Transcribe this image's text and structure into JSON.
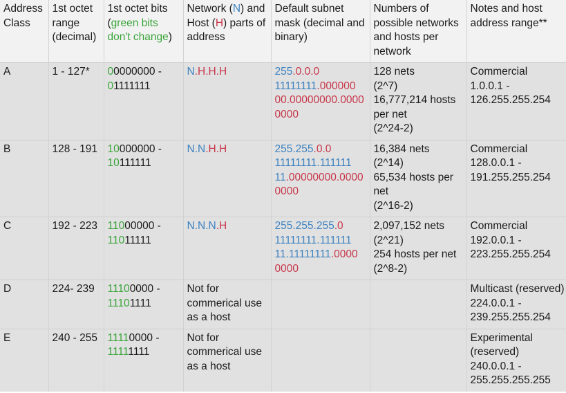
{
  "colors": {
    "network": "#3d82c0",
    "host": "#c7364a",
    "fixed_bits": "#3aa43a",
    "header_bg": "#f2f2f2",
    "row_bg": "#e1e1e1"
  },
  "header": {
    "col1": "Address Class",
    "col2": "1st octet range (decimal)",
    "col3": {
      "pre": "1st octet bits (",
      "green": "green bits don't change",
      "post": ")"
    },
    "col4": {
      "a": "Network (",
      "n": "N",
      "b": ") and Host (",
      "h": "H",
      "c": ") parts of address"
    },
    "col5": "Default subnet mask (decimal and binary)",
    "col6": "Numbers of possible networks and hosts per network",
    "col7": "Notes and host address range**"
  },
  "rows": [
    {
      "cls": "A",
      "range": "1 - 127*",
      "bits": {
        "start_fixed": "0",
        "start_rest": "0000000 -",
        "end_fixed": "0",
        "end_rest": "1111111"
      },
      "parts": {
        "n": "N",
        "h": ".H.H.H"
      },
      "mask": {
        "dec_n": "255",
        "dec_h": ".0.0.0",
        "bin1_n": "11111111",
        "bin1_h": ".000000",
        "bin2_n": "",
        "bin2_h": "00.00000000.0000",
        "bin3_h": "0000"
      },
      "counts": [
        "128 nets",
        "(2^7)",
        "16,777,214 hosts",
        "per net",
        "(2^24-2)"
      ],
      "notes": [
        "Commercial",
        "1.0.0.1 -",
        "126.255.255.254"
      ]
    },
    {
      "cls": "B",
      "range": "128 - 191",
      "bits": {
        "start_fixed": "10",
        "start_rest": "000000 -",
        "end_fixed": "10",
        "end_rest": "111111"
      },
      "parts": {
        "n": "N.N",
        "h": ".H.H"
      },
      "mask": {
        "dec_n": "255.255",
        "dec_h": ".0.0",
        "bin1_n": "11111111.111111",
        "bin1_h": "",
        "bin2_n": "11",
        "bin2_h": ".00000000.0000",
        "bin3_h": "0000"
      },
      "counts": [
        "16,384 nets",
        "(2^14)",
        "65,534 hosts per",
        "net",
        "(2^16-2)"
      ],
      "notes": [
        "Commercial",
        "128.0.0.1 -",
        "191.255.255.254"
      ]
    },
    {
      "cls": "C",
      "range": "192 - 223",
      "bits": {
        "start_fixed": "110",
        "start_rest": "00000 -",
        "end_fixed": "110",
        "end_rest": "11111"
      },
      "parts": {
        "n": "N.N.N",
        "h": ".H"
      },
      "mask": {
        "dec_n": "255.255.255",
        "dec_h": ".0",
        "bin1_n": "11111111.111111",
        "bin1_h": "",
        "bin2_n": "11.11111111",
        "bin2_h": ".0000",
        "bin3_h": "0000"
      },
      "counts": [
        "2,097,152 nets",
        "(2^21)",
        "254 hosts per net",
        "(2^8-2)"
      ],
      "notes": [
        "Commercial",
        "192.0.0.1 -",
        "223.255.255.254"
      ]
    },
    {
      "cls": "D",
      "range": "224- 239",
      "bits": {
        "start_fixed": "1110",
        "start_rest": "0000 -",
        "end_fixed": "1110",
        "end_rest": "1111"
      },
      "parts_text": "Not for commerical use as a host",
      "notes": [
        "Multicast (reserved)",
        "224.0.0.1 -",
        "239.255.255.254"
      ]
    },
    {
      "cls": "E",
      "range": "240 - 255",
      "bits": {
        "start_fixed": "1111",
        "start_rest": "0000 -",
        "end_fixed": "1111",
        "end_rest": "1111"
      },
      "parts_text": "Not for commerical use as a host",
      "notes": [
        "Experimental",
        "(reserved)",
        "240.0.0.1 -",
        "255.255.255.255"
      ]
    }
  ]
}
